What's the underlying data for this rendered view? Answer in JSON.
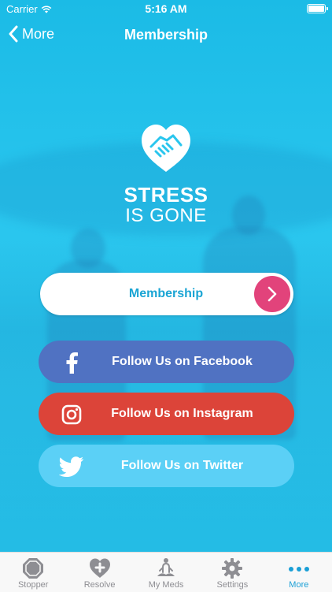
{
  "status_bar": {
    "carrier": "Carrier",
    "time": "5:16 AM"
  },
  "nav": {
    "back_label": "More",
    "title": "Membership"
  },
  "brand": {
    "line1": "STRESS",
    "line2": "IS GONE",
    "logo_icon": "heart-handshake-icon"
  },
  "buttons": {
    "membership": {
      "label": "Membership",
      "icon": "chevron-right-icon",
      "color": "#e2437b"
    },
    "facebook": {
      "label": "Follow Us on Facebook",
      "icon": "facebook-icon",
      "color": "#5072c2"
    },
    "instagram": {
      "label": "Follow Us on Instagram",
      "icon": "instagram-icon",
      "color": "#dc4439"
    },
    "twitter": {
      "label": "Follow Us on Twitter",
      "icon": "twitter-icon",
      "color": "#5bd0f6"
    }
  },
  "tabbar": {
    "items": [
      {
        "label": "Stopper",
        "icon": "stop-octagon-icon"
      },
      {
        "label": "Resolve",
        "icon": "heart-plus-icon"
      },
      {
        "label": "My Meds",
        "icon": "meditation-icon"
      },
      {
        "label": "Settings",
        "icon": "gear-icon"
      },
      {
        "label": "More",
        "icon": "more-dots-icon",
        "active": true
      }
    ]
  },
  "colors": {
    "background": "#2ac6ee",
    "accent": "#1a9fd6"
  }
}
